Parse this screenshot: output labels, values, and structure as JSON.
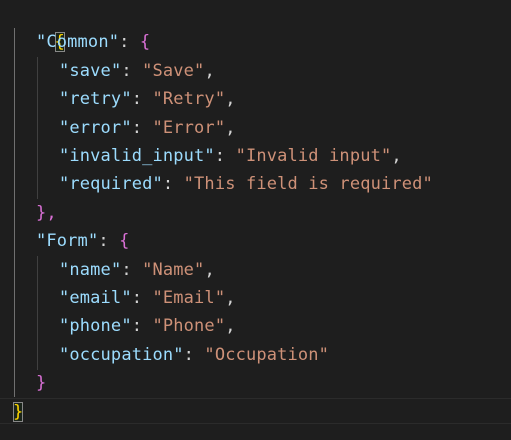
{
  "editor": {
    "language": "json",
    "root_open": "{",
    "root_close": "}",
    "sections": [
      {
        "key": "Common",
        "open": "{",
        "close": "},",
        "entries": [
          {
            "key": "save",
            "value": "Save"
          },
          {
            "key": "retry",
            "value": "Retry"
          },
          {
            "key": "error",
            "value": "Error"
          },
          {
            "key": "invalid_input",
            "value": "Invalid input"
          },
          {
            "key": "required",
            "value": "This field is required"
          }
        ]
      },
      {
        "key": "Form",
        "open": "{",
        "close": "}",
        "entries": [
          {
            "key": "name",
            "value": "Name"
          },
          {
            "key": "email",
            "value": "Email"
          },
          {
            "key": "phone",
            "value": "Phone"
          },
          {
            "key": "occupation",
            "value": "Occupation"
          }
        ]
      }
    ]
  },
  "colors": {
    "background": "#1e1e1e",
    "key": "#9cdcfe",
    "string": "#ce9178",
    "punctuation": "#d4d4d4",
    "bracket_level_1": "#ffd700",
    "bracket_level_2": "#da70d6",
    "bracket_level_3": "#179fff"
  }
}
